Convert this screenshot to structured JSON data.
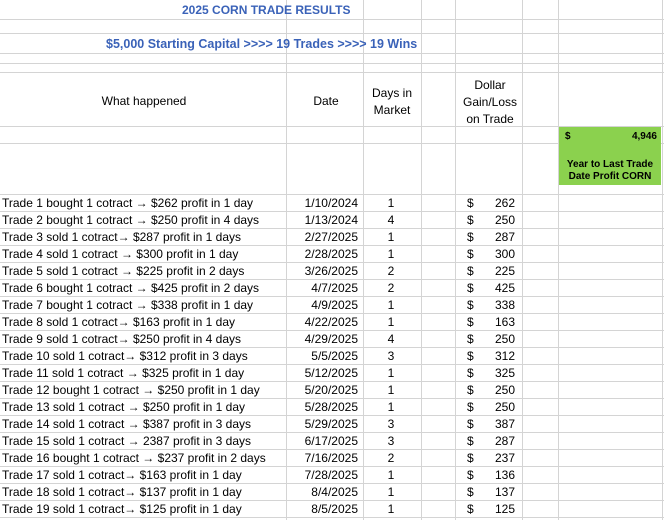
{
  "title": "2025 CORN TRADE RESULTS",
  "subtitle": "$5,000 Starting Capital >>>>  19 Trades >>>>  19 Wins",
  "headers": {
    "what": "What happened",
    "date": "Date",
    "days": "Days in Market",
    "dollar": "Dollar Gain/Loss on Trade"
  },
  "summary": {
    "currency": "$",
    "value": "4,946",
    "label": "Year to Last Trade Date Profit CORN",
    "bg_color": "#8bd14e"
  },
  "title_color": "#3a62b8",
  "trades": [
    {
      "desc": "Trade 1 bought 1 cotract → $262 profit in 1 day",
      "date": "1/10/2024",
      "days": "1",
      "dol": "$",
      "amt": "262"
    },
    {
      "desc": "Trade 2 bought 1 cotract → $250 profit in 4 days",
      "date": "1/13/2024",
      "days": "4",
      "dol": "$",
      "amt": "250"
    },
    {
      "desc": "Trade 3 sold 1 cotract→ $287 profit in 1 days",
      "date": "2/27/2025",
      "days": "1",
      "dol": "$",
      "amt": "287"
    },
    {
      "desc": "Trade 4 sold 1 cotract → $300 profit in 1 day",
      "date": "2/28/2025",
      "days": "1",
      "dol": "$",
      "amt": "300"
    },
    {
      "desc": "Trade 5 sold 1 cotract → $225 profit in 2 days",
      "date": "3/26/2025",
      "days": "2",
      "dol": "$",
      "amt": "225"
    },
    {
      "desc": "Trade 6 bought 1 cotract → $425 profit in 2 days",
      "date": "4/7/2025",
      "days": "2",
      "dol": "$",
      "amt": "425"
    },
    {
      "desc": "Trade 7 bought 1 cotract → $338 profit in 1 day",
      "date": "4/9/2025",
      "days": "1",
      "dol": "$",
      "amt": "338"
    },
    {
      "desc": "Trade 8 sold 1 cotract→ $163 profit in 1 day",
      "date": "4/22/2025",
      "days": "1",
      "dol": "$",
      "amt": "163"
    },
    {
      "desc": "Trade 9 sold 1 cotract→ $250 profit in 4 days",
      "date": "4/29/2025",
      "days": "4",
      "dol": "$",
      "amt": "250"
    },
    {
      "desc": "Trade 10 sold 1 cotract→ $312 profit in 3 days",
      "date": "5/5/2025",
      "days": "3",
      "dol": "$",
      "amt": "312"
    },
    {
      "desc": "Trade 11 sold 1 cotract → $325 profit in 1 day",
      "date": "5/12/2025",
      "days": "1",
      "dol": "$",
      "amt": "325"
    },
    {
      "desc": "Trade 12 bought 1 cotract → $250 profit in 1 day",
      "date": "5/20/2025",
      "days": "1",
      "dol": "$",
      "amt": "250"
    },
    {
      "desc": "Trade 13 sold 1 cotract → $250 profit in 1 day",
      "date": "5/28/2025",
      "days": "1",
      "dol": "$",
      "amt": "250"
    },
    {
      "desc": "Trade 14 sold 1 cotract → $387 profit in 3 days",
      "date": "5/29/2025",
      "days": "3",
      "dol": "$",
      "amt": "387"
    },
    {
      "desc": "Trade 15 sold 1 cotract → 2387 profit in 3 days",
      "date": "6/17/2025",
      "days": "3",
      "dol": "$",
      "amt": "287"
    },
    {
      "desc": "Trade 16 bought 1 cotract → $237 profit in 2 days",
      "date": "7/16/2025",
      "days": "2",
      "dol": "$",
      "amt": "237"
    },
    {
      "desc": "Trade 17 sold 1 cotract→ $163 profit in 1 day",
      "date": "7/28/2025",
      "days": "1",
      "dol": "$",
      "amt": "136"
    },
    {
      "desc": "Trade 18 sold 1 cotract→ $137 profit in 1 day",
      "date": "8/4/2025",
      "days": "1",
      "dol": "$",
      "amt": "137"
    },
    {
      "desc": "Trade 19 sold 1 cotract→ $125 profit in 1 day",
      "date": "8/5/2025",
      "days": "1",
      "dol": "$",
      "amt": "125"
    }
  ]
}
